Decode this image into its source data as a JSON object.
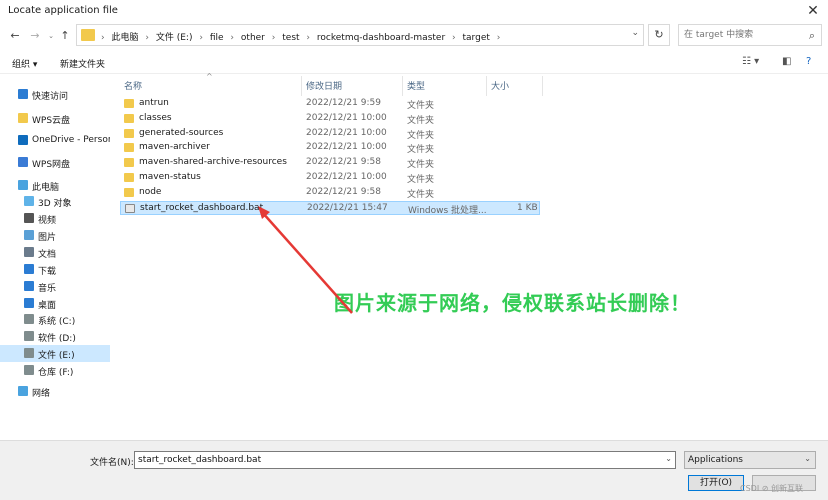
{
  "window": {
    "title": "Locate application file",
    "close_glyph": "✕"
  },
  "nav": {
    "back_icon": "arrow-left-icon",
    "forward_icon": "arrow-right-icon",
    "up_icon": "arrow-up-icon",
    "breadcrumb": [
      "此电脑",
      "文件 (E:)",
      "file",
      "other",
      "test",
      "rocketmq-dashboard-master",
      "target"
    ],
    "search_placeholder": "在 target 中搜索"
  },
  "toolbar": {
    "organize": "组织 ▾",
    "new_folder": "新建文件夹"
  },
  "sidebar": {
    "items": [
      {
        "label": "快速访问",
        "icon": "star-icon",
        "color": "#2b7cd3",
        "indent": 0
      },
      {
        "label": "WPS云盘",
        "icon": "cloud-folder-icon",
        "color": "#f2c94c",
        "indent": 0
      },
      {
        "label": "OneDrive - Persona",
        "icon": "cloud-icon",
        "color": "#0f6cbd",
        "indent": 0
      },
      {
        "label": "WPS网盘",
        "icon": "wps-cloud-icon",
        "color": "#3a7bd5",
        "indent": 0
      },
      {
        "label": "此电脑",
        "icon": "computer-icon",
        "color": "#4aa3df",
        "indent": 0
      },
      {
        "label": "3D 对象",
        "icon": "cube-icon",
        "color": "#5fb3e8",
        "indent": 1
      },
      {
        "label": "视频",
        "icon": "video-icon",
        "color": "#555555",
        "indent": 1
      },
      {
        "label": "图片",
        "icon": "picture-icon",
        "color": "#5aa0d6",
        "indent": 1
      },
      {
        "label": "文档",
        "icon": "document-icon",
        "color": "#6b7b8c",
        "indent": 1
      },
      {
        "label": "下载",
        "icon": "download-icon",
        "color": "#2b7cd3",
        "indent": 1
      },
      {
        "label": "音乐",
        "icon": "music-icon",
        "color": "#2b7cd3",
        "indent": 1
      },
      {
        "label": "桌面",
        "icon": "desktop-icon",
        "color": "#2b7cd3",
        "indent": 1
      },
      {
        "label": "系统 (C:)",
        "icon": "drive-icon",
        "color": "#7f8c8d",
        "indent": 1
      },
      {
        "label": "软件 (D:)",
        "icon": "drive-icon",
        "color": "#7f8c8d",
        "indent": 1
      },
      {
        "label": "文件 (E:)",
        "icon": "drive-icon",
        "color": "#7f8c8d",
        "indent": 1,
        "selected": true
      },
      {
        "label": "仓库 (F:)",
        "icon": "drive-icon",
        "color": "#7f8c8d",
        "indent": 1
      },
      {
        "label": "网络",
        "icon": "network-icon",
        "color": "#4aa3df",
        "indent": 0
      }
    ]
  },
  "columns": {
    "name": "名称",
    "date": "修改日期",
    "type": "类型",
    "size": "大小"
  },
  "files": [
    {
      "name": "antrun",
      "date": "2022/12/21 9:59",
      "type": "文件夹",
      "size": "",
      "kind": "folder"
    },
    {
      "name": "classes",
      "date": "2022/12/21 10:00",
      "type": "文件夹",
      "size": "",
      "kind": "folder"
    },
    {
      "name": "generated-sources",
      "date": "2022/12/21 10:00",
      "type": "文件夹",
      "size": "",
      "kind": "folder"
    },
    {
      "name": "maven-archiver",
      "date": "2022/12/21 10:00",
      "type": "文件夹",
      "size": "",
      "kind": "folder"
    },
    {
      "name": "maven-shared-archive-resources",
      "date": "2022/12/21 9:58",
      "type": "文件夹",
      "size": "",
      "kind": "folder"
    },
    {
      "name": "maven-status",
      "date": "2022/12/21 10:00",
      "type": "文件夹",
      "size": "",
      "kind": "folder"
    },
    {
      "name": "node",
      "date": "2022/12/21 9:58",
      "type": "文件夹",
      "size": "",
      "kind": "folder"
    },
    {
      "name": "start_rocket_dashboard.bat",
      "date": "2022/12/21 15:47",
      "type": "Windows 批处理...",
      "size": "1 KB",
      "kind": "bat",
      "selected": true
    }
  ],
  "watermark": "图片来源于网络，侵权联系站长删除！",
  "footer": {
    "filename_label": "文件名(N):",
    "filename_value": "start_rocket_dashboard.bat",
    "filter_value": "Applications",
    "open_label": "打开(O)",
    "corner_watermark": "CSDI  ⊘ 创新互联"
  },
  "colors": {
    "selection": "#cce8ff",
    "annotation_arrow": "#e53935",
    "watermark": "#33cc55",
    "accent": "#0078d7"
  }
}
